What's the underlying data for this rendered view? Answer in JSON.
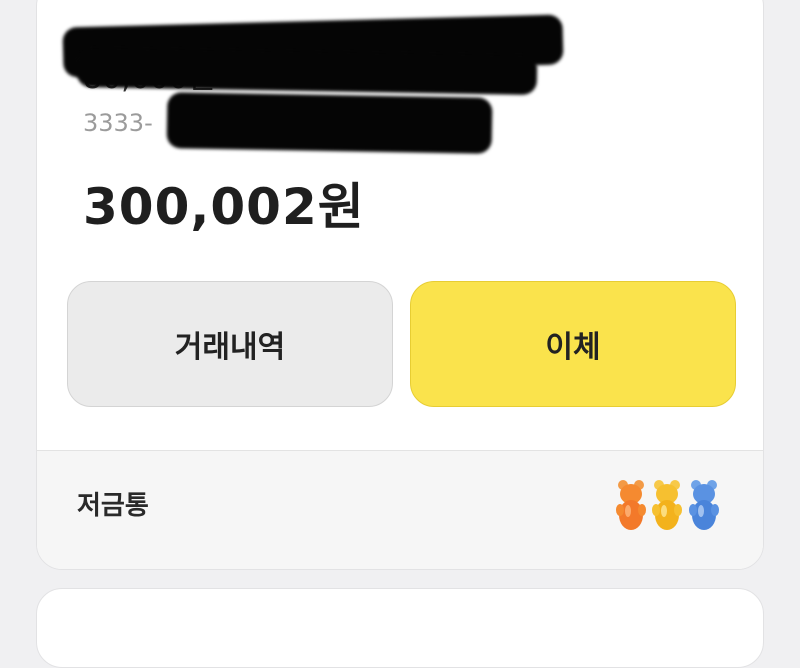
{
  "account": {
    "name_visible": "80,000원",
    "number_visible": "3333-",
    "balance": "300,002원"
  },
  "actions": {
    "history_label": "거래내역",
    "transfer_label": "이체"
  },
  "savings": {
    "label": "저금통",
    "icon": "gummy-bears-icon"
  },
  "colors": {
    "accent_yellow": "#fae34c",
    "button_gray": "#ebebeb",
    "background": "#f0f0f2"
  }
}
